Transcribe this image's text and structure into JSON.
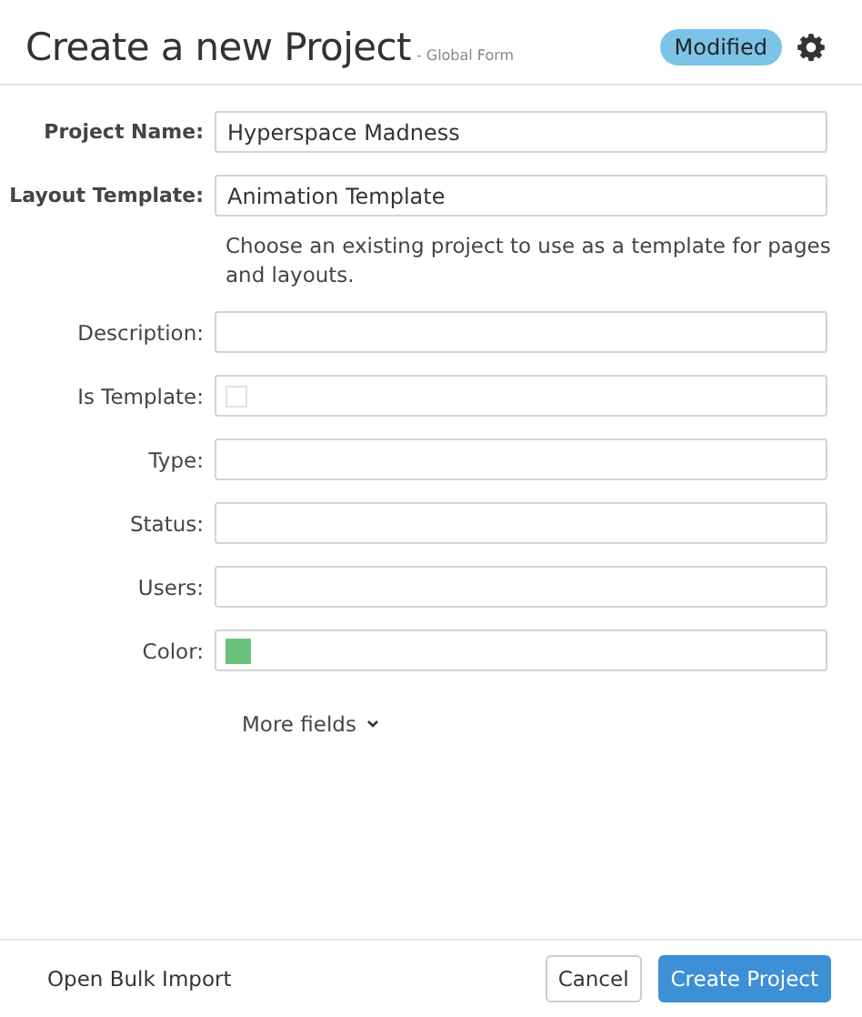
{
  "header": {
    "title": "Create a new Project",
    "subtitle": "- Global Form",
    "badge": "Modified"
  },
  "fields": [
    {
      "label": "Project Name:",
      "kind": "text",
      "required": true,
      "value": "Hyperspace Madness"
    },
    {
      "label": "Layout Template:",
      "kind": "text",
      "required": true,
      "value": "Animation Template",
      "hint": "Choose an existing project to use as a template for pages and layouts."
    },
    {
      "label": "Description:",
      "kind": "text",
      "required": false
    },
    {
      "label": "Is Template:",
      "kind": "checkbox",
      "required": false,
      "checked": false
    },
    {
      "label": "Type:",
      "kind": "text",
      "required": false
    },
    {
      "label": "Status:",
      "kind": "text",
      "required": false
    },
    {
      "label": "Users:",
      "kind": "text",
      "required": false
    },
    {
      "label": "Color:",
      "kind": "color",
      "required": false,
      "color": "#6cc17a"
    }
  ],
  "more_fields": "More fields",
  "footer": {
    "link": "Open Bulk Import",
    "cancel": "Cancel",
    "submit": "Create Project"
  }
}
